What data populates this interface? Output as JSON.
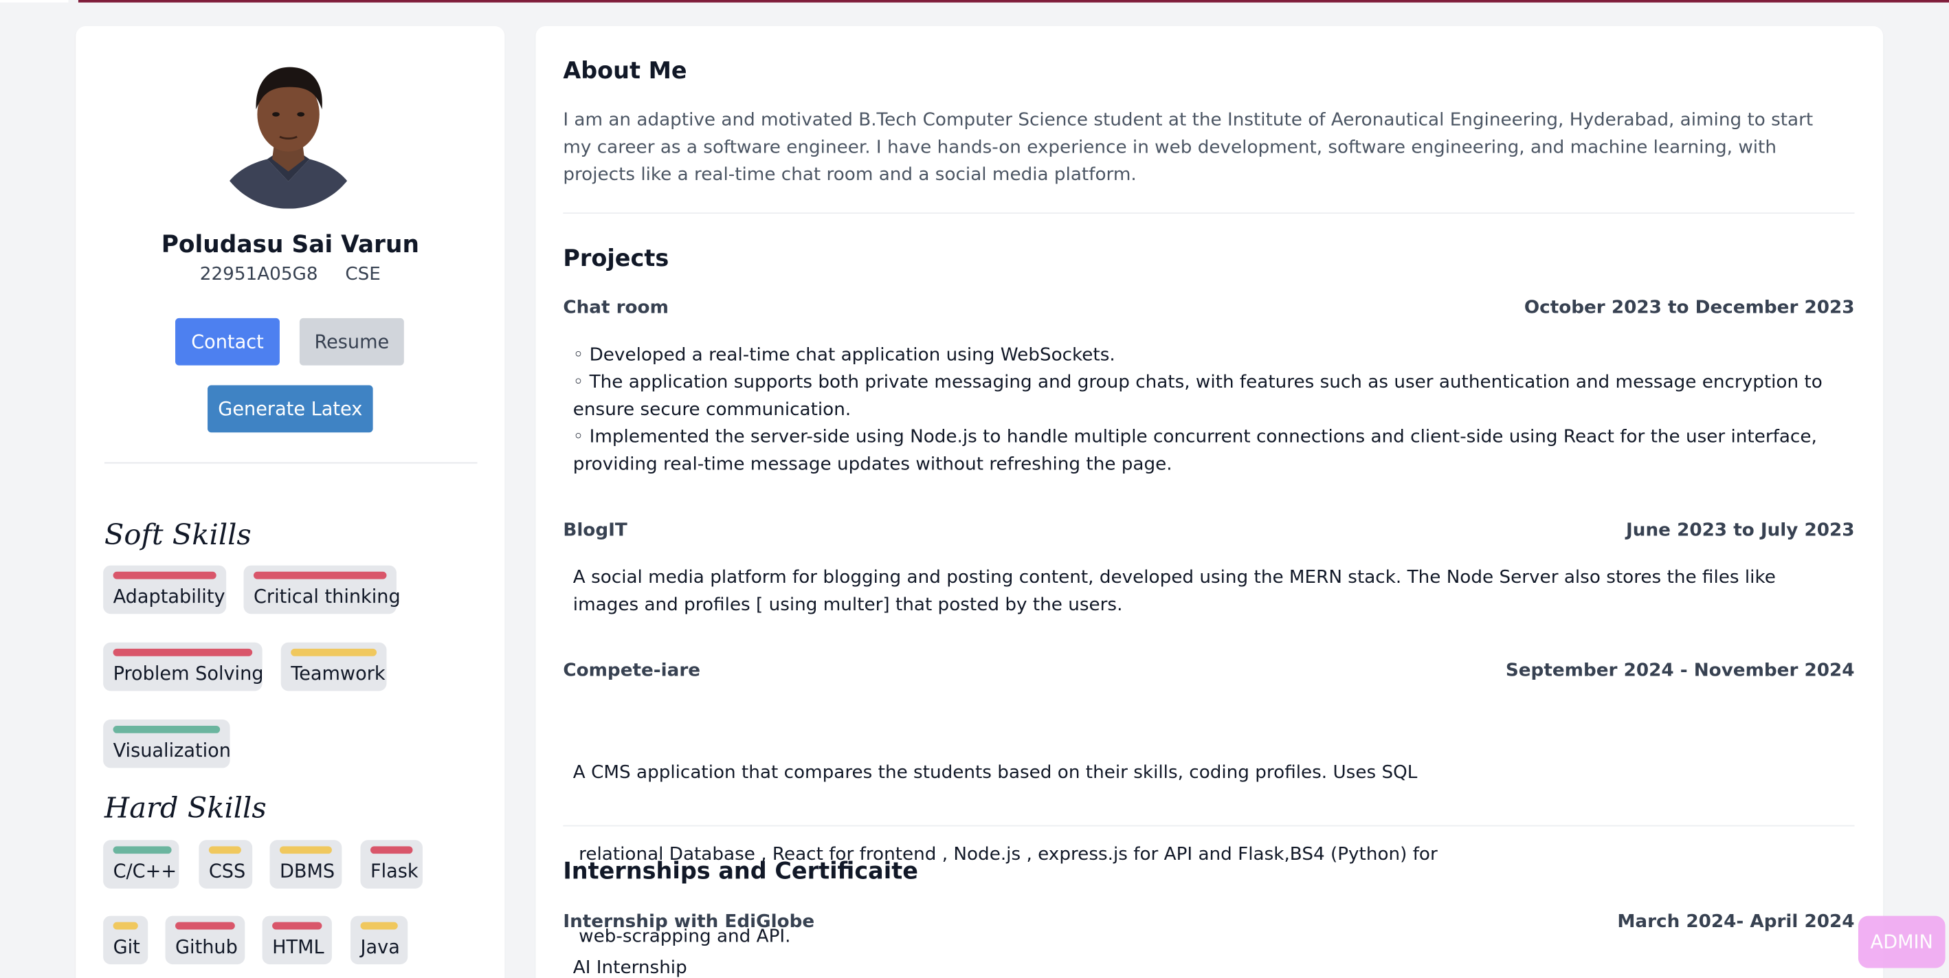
{
  "profile": {
    "name": "Poludasu Sai Varun",
    "roll": "22951A05G8",
    "branch": "CSE",
    "contact_label": "Contact",
    "resume_label": "Resume",
    "latex_label": "Generate Latex"
  },
  "soft_skills": {
    "heading": "Soft Skills",
    "items": [
      {
        "label": "Adaptability",
        "level_color": "#d9566a"
      },
      {
        "label": "Critical thinking",
        "level_color": "#d9566a"
      },
      {
        "label": "Problem Solving",
        "level_color": "#d9566a"
      },
      {
        "label": "Teamwork",
        "level_color": "#f0c85e"
      },
      {
        "label": "Visualization",
        "level_color": "#6bb59f"
      }
    ]
  },
  "hard_skills": {
    "heading": "Hard Skills",
    "items": [
      {
        "label": "C/C++",
        "level_color": "#6bb59f"
      },
      {
        "label": "CSS",
        "level_color": "#f0c85e"
      },
      {
        "label": "DBMS",
        "level_color": "#f0c85e"
      },
      {
        "label": "Flask",
        "level_color": "#d9566a"
      },
      {
        "label": "Git",
        "level_color": "#f0c85e"
      },
      {
        "label": "Github",
        "level_color": "#d9566a"
      },
      {
        "label": "HTML",
        "level_color": "#d9566a"
      },
      {
        "label": "Java",
        "level_color": "#f0c85e"
      }
    ]
  },
  "about": {
    "heading": "About Me",
    "text": "I am an adaptive and motivated B.Tech Computer Science student at the Institute of Aeronautical Engineering, Hyderabad, aiming to start my career as a software engineer. I have hands-on experience in web development, software engineering, and machine learning, with projects like a real-time chat room and a social media platform."
  },
  "projects": {
    "heading": "Projects",
    "items": [
      {
        "title": "Chat room",
        "date": "October 2023 to December 2023",
        "lines": [
          "◦ Developed a real-time chat application using WebSockets.",
          "◦ The application supports both private messaging and group chats, with features such as user authentication and message encryption to ensure secure communication.",
          "◦ Implemented the server-side using Node.js to handle multiple concurrent connections and client-side using React for the user interface, providing real-time message updates without refreshing the page."
        ]
      },
      {
        "title": "BlogIT",
        "date": "June 2023 to July 2023",
        "lines": [
          "A social media platform for blogging and posting content, developed using the MERN stack. The Node Server also stores the files like images and profiles [ using multer] that posted by the users."
        ]
      },
      {
        "title": "Compete-iare",
        "date": "September 2024 - November 2024",
        "lines": [
          "A CMS application that compares the students based on their skills, coding profiles. Uses SQL",
          " relational Database , React for frontend , Node.js , express.js for API and Flask,BS4 (Python) for",
          " web-scrapping and API."
        ]
      }
    ]
  },
  "internships": {
    "heading": "Internships and Certificaite",
    "items": [
      {
        "title": "Internship with EdiGlobe",
        "date": "March 2024- April 2024",
        "lines": [
          "AI Internship"
        ]
      }
    ]
  },
  "admin_label": "ADMIN"
}
